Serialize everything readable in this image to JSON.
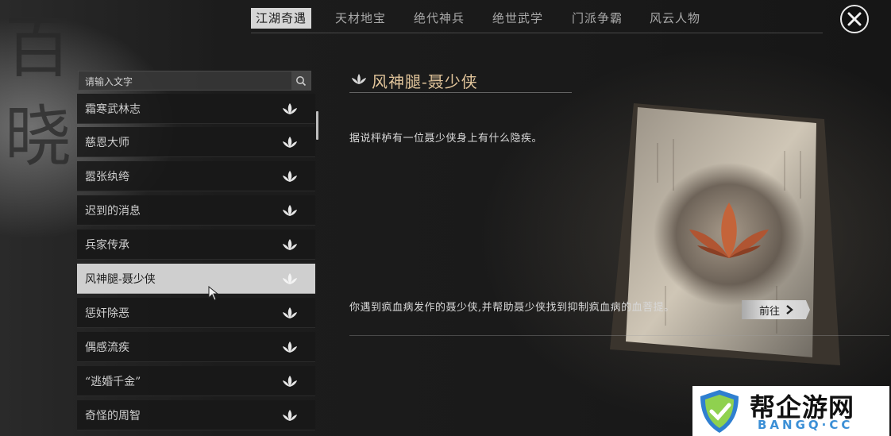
{
  "background_glyphs": [
    "百",
    "晓"
  ],
  "tabs": [
    {
      "label": "江湖奇遇",
      "active": true
    },
    {
      "label": "天材地宝",
      "active": false
    },
    {
      "label": "绝代神兵",
      "active": false
    },
    {
      "label": "绝世武学",
      "active": false
    },
    {
      "label": "门派争霸",
      "active": false
    },
    {
      "label": "风云人物",
      "active": false
    }
  ],
  "search": {
    "placeholder": "请输入文字"
  },
  "quests": [
    {
      "label": "霜寒武林志"
    },
    {
      "label": "慈恩大师"
    },
    {
      "label": "嚣张纨绔"
    },
    {
      "label": "迟到的消息"
    },
    {
      "label": "兵家传承"
    },
    {
      "label": "风神腿-聂少侠",
      "selected": true
    },
    {
      "label": "惩奸除恶"
    },
    {
      "label": "偶感流疾"
    },
    {
      "label": "“逃婚千金”"
    },
    {
      "label": "奇怪的周智"
    }
  ],
  "detail": {
    "title": "风神腿-聂少侠",
    "description": "据说枰栌有一位聂少侠身上有什么隐疾。",
    "objective": "你遇到疯血病发作的聂少侠,并帮助聂少侠找到抑制疯血病的血菩提。",
    "goto_label": "前往"
  },
  "watermark": {
    "main": "帮企游网",
    "sub": "BANGQ·CC"
  },
  "colors": {
    "accent_gold": "#e2c59b",
    "selected_bg": "#cfcfcf",
    "leaf_orange": "#c4643a"
  }
}
